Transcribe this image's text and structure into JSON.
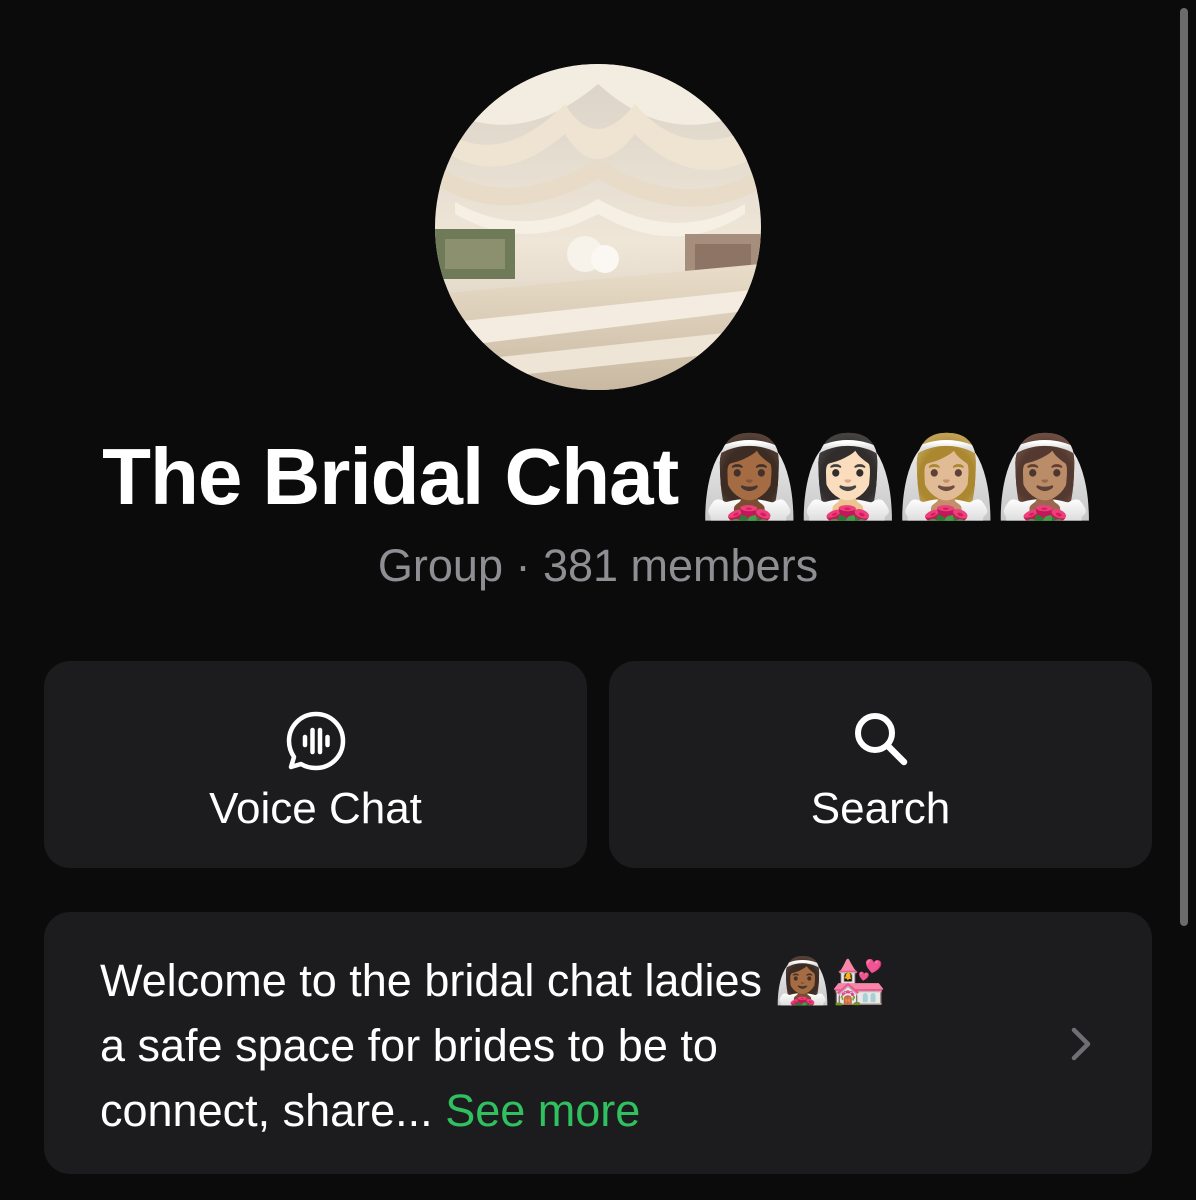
{
  "group": {
    "title": "The Bridal Chat 👰🏾‍♀️👰🏻‍♀️👰🏼‍♀️👰🏽‍♀️",
    "subtitle": "Group · 381 members"
  },
  "actions": {
    "voice_chat_label": "Voice Chat",
    "search_label": "Search"
  },
  "description": {
    "line1": "Welcome to the bridal chat ladies 👰🏾‍♀️💒",
    "line2": "a safe space for brides to be to",
    "line3": "connect, share...",
    "see_more": "See more"
  },
  "colors": {
    "background": "#0b0b0b",
    "card": "#1c1c1e",
    "secondary_text": "#8e8e93",
    "accent": "#30c060"
  },
  "icons": {
    "voice_chat": "voice-chat-bubble-icon",
    "search": "magnifier-icon",
    "chevron": "chevron-right-icon"
  }
}
